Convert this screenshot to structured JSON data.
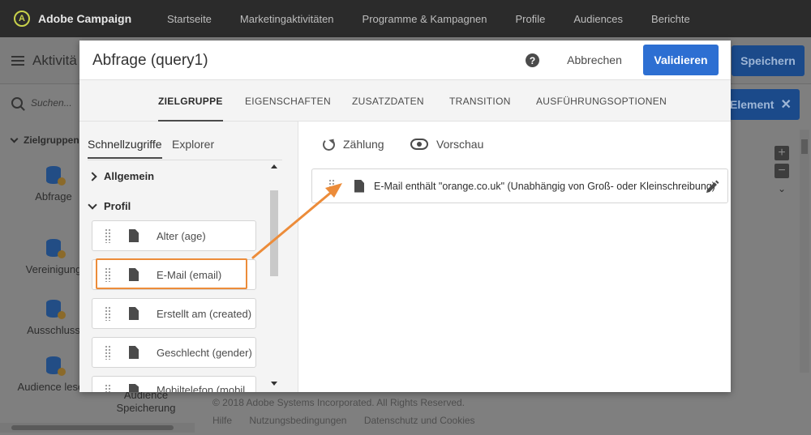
{
  "topbar": {
    "logo_text": "Adobe Campaign",
    "nav": [
      "Startseite",
      "Marketingaktivitäten",
      "Programme & Kampagnen",
      "Profile",
      "Audiences",
      "Berichte"
    ]
  },
  "background": {
    "title": "Aktivitä",
    "save_label": "Speichern",
    "search_placeholder": "Suchen...",
    "section": "Zielgruppen",
    "activities": [
      "Abfrage",
      "Vereinigung",
      "Ausschluss",
      "Audience lesen"
    ],
    "element_chip": "Element",
    "bottom_label": "Audience Speicherung",
    "footer_copyright": "© 2018 Adobe Systems Incorporated. All Rights Reserved.",
    "footer_links": [
      "Hilfe",
      "Nutzungsbedingungen",
      "Datenschutz und Cookies"
    ]
  },
  "dialog": {
    "title": "Abfrage (query1)",
    "cancel_label": "Abbrechen",
    "validate_label": "Validieren",
    "tabs": [
      "ZIELGRUPPE",
      "EIGENSCHAFTEN",
      "ZUSATZDATEN",
      "TRANSITION",
      "AUSFÜHRUNGSOPTIONEN"
    ],
    "left": {
      "tabs": [
        "Schnellzugriffe",
        "Explorer"
      ],
      "group_general": "Allgemein",
      "group_profile": "Profil",
      "fields": [
        "Alter (age)",
        "E-Mail (email)",
        "Erstellt am (created)",
        "Geschlecht (gender)",
        "Mobiltelefon (mobil"
      ]
    },
    "right": {
      "count_label": "Zählung",
      "preview_label": "Vorschau",
      "condition": "E-Mail enthält \"orange.co.uk\" (Unabhängig von Groß- oder Kleinschreibung)"
    }
  },
  "colors": {
    "accent": "#2d6fd2",
    "highlight": "#ec8c3a",
    "topbar": "#2b2b2b"
  }
}
